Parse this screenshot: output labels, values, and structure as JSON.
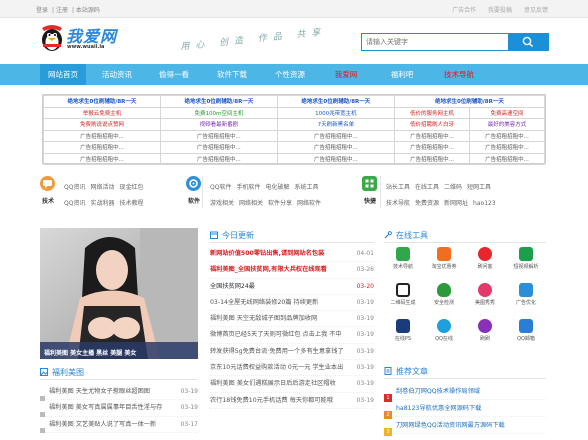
{
  "topbar": {
    "left_links": [
      "登录",
      "注册",
      "本站源码"
    ],
    "right_links": [
      "广告合作",
      "我要投稿",
      "意见反馈"
    ]
  },
  "header": {
    "logo_text": "我爱网",
    "logo_url_text": "www.wuaii.la",
    "slogan": "用心 创造 作品 共享",
    "search_placeholder": "请输入关键字"
  },
  "nav": [
    {
      "label": "网站首页",
      "hot": false
    },
    {
      "label": "活动资讯",
      "hot": false
    },
    {
      "label": "偷得一看",
      "hot": false
    },
    {
      "label": "软件下载",
      "hot": false
    },
    {
      "label": "个性资源",
      "hot": false
    },
    {
      "label": "我爱网",
      "hot": true
    },
    {
      "label": "福利吧",
      "hot": false
    },
    {
      "label": "技术导航",
      "hot": true
    }
  ],
  "ad_grid": {
    "rows": [
      [
        "绝地求生0位刷辅助/8R一天",
        "绝地求生0位刷辅助/8R一天",
        "绝地求生0位刷辅助/8R一天",
        "绝地求生0位刷辅助/8R一天"
      ],
      [
        "举报云免费主机",
        "免费100m空间主机",
        "1000兆带宽主机",
        "低价的服务网主机",
        "免费高速空间"
      ],
      [
        "免费刷说说点赞网",
        "视频看最新番剧",
        "7天刷新黑名单",
        "低价招聘刷人白牙",
        "最好的美容方式"
      ],
      [
        "广告招租招租中...",
        "广告招租招租中...",
        "广告招租招租中...",
        "广告招租招租中...",
        "广告招租招租中..."
      ],
      [
        "广告招租招租中...",
        "广告招租招租中...",
        "广告招租招租中...",
        "广告招租招租中...",
        "广告招租招租中..."
      ],
      [
        "广告招租招租中...",
        "广告招租招租中...",
        "广告招租招租中...",
        "广告招租招租中...",
        "广告招租招租中..."
      ]
    ],
    "colors": {
      "red": "#d42020",
      "green": "#16a020",
      "blue": "#1a56c8",
      "purple": "#7a2fb0",
      "gray": "#666666"
    }
  },
  "categories": [
    {
      "label": "技术",
      "links": [
        "QQ资讯",
        "网络活动",
        "现金红包",
        "QQ资讯",
        "实战利器",
        "技术教程"
      ],
      "color": "#f29a3b"
    },
    {
      "label": "软件",
      "links": [
        "QQ软件",
        "手机软件",
        "电化破解",
        "系统工具",
        "游戏相关",
        "网络相关",
        "软件分享",
        "网络软件"
      ],
      "color": "#2f8fd7"
    },
    {
      "label": "快捷",
      "links": [
        "站长工具",
        "在线工具",
        "二维码",
        "短网工具",
        "技术导航",
        "免费资源",
        "新网网址",
        "hao123"
      ],
      "color": "#3aaa49"
    }
  ],
  "banner": {
    "caption": "福利美图 美女主播 黑丝 美腿 美女"
  },
  "today": {
    "title": "今日更新",
    "items": [
      {
        "text": "新网站价值500零钻出售,请到网站名包装",
        "date": "04-01",
        "color": "#d42020",
        "bold": true
      },
      {
        "text": "福利美图_全国扶贫网,有限大兵权在线观看",
        "date": "03-26",
        "color": "#d42020",
        "bold": true
      },
      {
        "text": "全国扶贫网24最",
        "date": "03-20",
        "color": "#333333",
        "bold": false
      },
      {
        "text": "03-14全屋无线网络装修20篇 持续更新",
        "date": "03-19",
        "color": "#555555",
        "bold": false
      },
      {
        "text": "福利美图 天空无敌城子图到品牌加收网",
        "date": "03-19",
        "color": "#555555",
        "bold": false
      },
      {
        "text": "微博首页已经5天了天则可微红包 点击上我 不中",
        "date": "03-19",
        "color": "#555555",
        "bold": false
      },
      {
        "text": "转发获得5g免费台流·免费用一个多有生意拿钱了",
        "date": "03-19",
        "color": "#555555",
        "bold": false
      },
      {
        "text": "京东10元话费权益购款活动 0元一元 学生业本出",
        "date": "03-19",
        "color": "#555555",
        "bold": false
      },
      {
        "text": "福利美图 美女们遇糕展示日后后游走社区帽收",
        "date": "03-19",
        "color": "#555555",
        "bold": false
      },
      {
        "text": "农行18钱免费10元手机话费 每天你都可能哦",
        "date": "03-19",
        "color": "#555555",
        "bold": false
      }
    ]
  },
  "welfare": {
    "title": "福利美图",
    "items": [
      {
        "text": "福利美图 天生尤物女子惹眼丝超困图",
        "date": "03-19"
      },
      {
        "text": "福利美图 美女写真属属事年目舌性淫与存",
        "date": "03-19"
      },
      {
        "text": "福利美图 文艺美贴人说了写真一体一新",
        "date": "03-17"
      }
    ]
  },
  "online_tools": {
    "title": "在线工具",
    "items": [
      {
        "label": "技术导航",
        "color": "#2ea84a"
      },
      {
        "label": "淘宝优惠券",
        "color": "#f06e1e"
      },
      {
        "label": "刷问客",
        "color": "#e6262b"
      },
      {
        "label": "短视频解析",
        "color": "#1c9e4c"
      },
      {
        "label": "二维码生成",
        "color": "#222222"
      },
      {
        "label": "安全检测",
        "color": "#2b9a3a"
      },
      {
        "label": "美图秀秀",
        "color": "#e23a6a"
      },
      {
        "label": "广告优化",
        "color": "#2a8fd8"
      },
      {
        "label": "在线PS",
        "color": "#1a3c7a"
      },
      {
        "label": "QQ在线",
        "color": "#1d9fe0"
      },
      {
        "label": "刷刷",
        "color": "#8a2fb8"
      },
      {
        "label": "QQ邮箱",
        "color": "#2a7ed6"
      }
    ]
  },
  "recommend": {
    "title": "推荐文章",
    "items": [
      {
        "text": "刮卷伯刀网QQ技术操作局领域",
        "num": "1",
        "color": "#e6262b"
      },
      {
        "text": "ha8123导航优惠全网源码下载",
        "num": "2",
        "color": "#f08a1e"
      },
      {
        "text": "刀网网绿色QQ活动资讯网最方源码下载",
        "num": "3",
        "color": "#f0b41e"
      }
    ]
  }
}
